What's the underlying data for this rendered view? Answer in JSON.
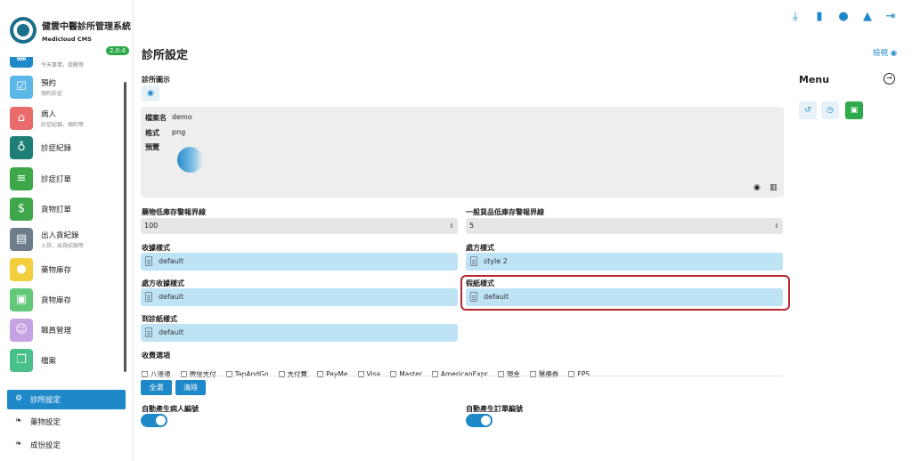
{
  "app": {
    "title": "健雲中醫診所管理系統",
    "subtitle": "Medicloud CMS",
    "version": "2.0.4"
  },
  "nav": {
    "items": [
      {
        "label": "",
        "sub": "今天事情，提醒等",
        "color": "#1f88c9",
        "icon": "calendar-icon"
      },
      {
        "label": "預約",
        "sub": "預約診症",
        "color": "#5bb7e8",
        "icon": "calendar-check-icon"
      },
      {
        "label": "病人",
        "sub": "診症紀錄，預約等",
        "color": "#ea6b6b",
        "icon": "bed-icon"
      },
      {
        "label": "診症紀錄",
        "sub": "",
        "color": "#1e7f76",
        "icon": "stethoscope-icon"
      },
      {
        "label": "診症訂單",
        "sub": "",
        "color": "#3da74a",
        "icon": "document-icon"
      },
      {
        "label": "貨物訂單",
        "sub": "",
        "color": "#3da74a",
        "icon": "invoice-icon"
      },
      {
        "label": "出入貨紀錄",
        "sub": "入貨，出貨紀錄等",
        "color": "#6d7d8b",
        "icon": "warehouse-icon"
      },
      {
        "label": "藥物庫存",
        "sub": "",
        "color": "#f3cf3e",
        "icon": "pills-icon"
      },
      {
        "label": "貨物庫存",
        "sub": "",
        "color": "#64c87a",
        "icon": "boxes-icon"
      },
      {
        "label": "職員管理",
        "sub": "",
        "color": "#c7a2e3",
        "icon": "staff-icon"
      },
      {
        "label": "檔案",
        "sub": "",
        "color": "#48c089",
        "icon": "files-icon"
      }
    ],
    "sub_items": [
      {
        "label": "診所設定",
        "active": true,
        "icon": "gears-icon"
      },
      {
        "label": "藥物設定",
        "active": false,
        "icon": "herb-icon"
      },
      {
        "label": "成份設定",
        "active": false,
        "icon": "herb-icon"
      }
    ]
  },
  "topbar": {
    "icons": [
      "download-icon",
      "clipboard-icon",
      "user-icon",
      "bell-icon",
      "logout-icon"
    ],
    "accent": "#1f88c9"
  },
  "page": {
    "title": "診所設定",
    "view_label": "檢視"
  },
  "form": {
    "clinic_icon_label": "診所圖示",
    "file": {
      "name_key": "檔案名",
      "name_value": "demo",
      "format_key": "格式",
      "format_value": "png",
      "preview_key": "預覽"
    },
    "drug_threshold_label": "藥物低庫存警報界線",
    "drug_threshold_value": "100",
    "general_threshold_label": "一般貨品低庫存警報界線",
    "general_threshold_value": "5",
    "receipt_style_label": "收據樣式",
    "receipt_style_value": "default",
    "prescription_style_label": "處方樣式",
    "prescription_style_value": "style 2",
    "prescription_receipt_label": "處方收據樣式",
    "prescription_receipt_value": "default",
    "leave_style_label": "假紙樣式",
    "leave_style_value": "default",
    "attendance_style_label": "到診紙樣式",
    "attendance_style_value": "default",
    "payment_label": "收費選項",
    "payment_options": [
      "八達通",
      "微信支付",
      "TapAndGo",
      "支付寶",
      "PayMe",
      "Visa",
      "Master",
      "AmericanExpr",
      "現金",
      "醫療券",
      "FPS"
    ],
    "select_all": "全選",
    "clear": "清除",
    "auto_patient_label": "自動產生病人編號",
    "auto_patient_on": true,
    "auto_order_label": "自動產生訂單編號",
    "auto_order_on": true
  },
  "menu": {
    "title": "Menu",
    "buttons": [
      {
        "icon": "history-icon",
        "bg": "#e7f1f8",
        "fg": "#1f88c9"
      },
      {
        "icon": "clock-icon",
        "bg": "#e7f1f8",
        "fg": "#1f88c9"
      },
      {
        "icon": "save-icon",
        "bg": "#2eaa4a",
        "fg": "#ffffff"
      }
    ]
  }
}
